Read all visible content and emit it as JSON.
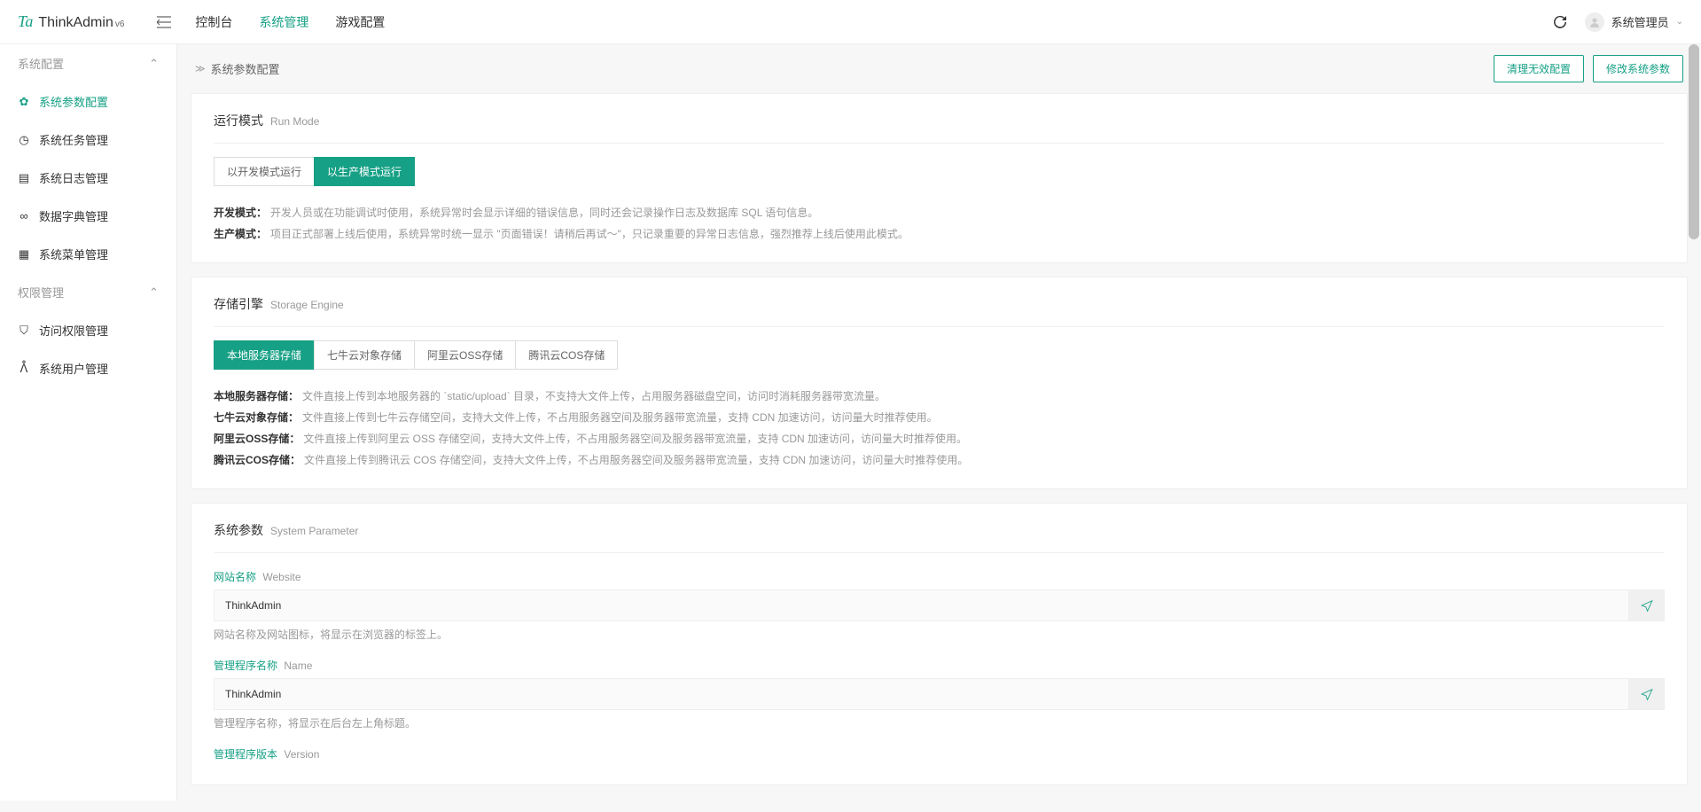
{
  "brand": {
    "name": "ThinkAdmin",
    "sup": "v6"
  },
  "topnav": [
    {
      "label": "控制台"
    },
    {
      "label": "系统管理"
    },
    {
      "label": "游戏配置"
    }
  ],
  "user": {
    "name": "系统管理员"
  },
  "sidebar": {
    "groups": [
      {
        "title": "系统配置",
        "items": [
          {
            "icon": "gear",
            "label": "系统参数配置",
            "active": true
          },
          {
            "icon": "clock",
            "label": "系统任务管理"
          },
          {
            "icon": "doc",
            "label": "系统日志管理"
          },
          {
            "icon": "loop",
            "label": "数据字典管理"
          },
          {
            "icon": "menu",
            "label": "系统菜单管理"
          }
        ]
      },
      {
        "title": "权限管理",
        "items": [
          {
            "icon": "shield",
            "label": "访问权限管理"
          },
          {
            "icon": "user",
            "label": "系统用户管理"
          }
        ]
      }
    ]
  },
  "page": {
    "breadcrumb_title": "系统参数配置",
    "actions": {
      "clean": "清理无效配置",
      "modify": "修改系统参数"
    }
  },
  "run_mode": {
    "title": "运行模式",
    "title_en": "Run Mode",
    "tabs": [
      "以开发模式运行",
      "以生产模式运行"
    ],
    "desc1_b": "开发模式：",
    "desc1": "开发人员或在功能调试时使用，系统异常时会显示详细的错误信息，同时还会记录操作日志及数据库 SQL 语句信息。",
    "desc2_b": "生产模式：",
    "desc2": "项目正式部署上线后使用，系统异常时统一显示 \"页面错误！请稍后再试～\"，只记录重要的异常日志信息，强烈推荐上线后使用此模式。"
  },
  "storage": {
    "title": "存储引擎",
    "title_en": "Storage Engine",
    "tabs": [
      "本地服务器存储",
      "七牛云对象存储",
      "阿里云OSS存储",
      "腾讯云COS存储"
    ],
    "d1_b": "本地服务器存储：",
    "d1": "文件直接上传到本地服务器的 `static/upload` 目录，不支持大文件上传，占用服务器磁盘空间，访问时消耗服务器带宽流量。",
    "d2_b": "七牛云对象存储：",
    "d2": "文件直接上传到七牛云存储空间，支持大文件上传，不占用服务器空间及服务器带宽流量，支持 CDN 加速访问，访问量大时推荐使用。",
    "d3_b": "阿里云OSS存储：",
    "d3": "文件直接上传到阿里云 OSS 存储空间，支持大文件上传，不占用服务器空间及服务器带宽流量，支持 CDN 加速访问，访问量大时推荐使用。",
    "d4_b": "腾讯云COS存储：",
    "d4": "文件直接上传到腾讯云 COS 存储空间，支持大文件上传，不占用服务器空间及服务器带宽流量，支持 CDN 加速访问，访问量大时推荐使用。"
  },
  "params": {
    "title": "系统参数",
    "title_en": "System Parameter",
    "fields": [
      {
        "label": "网站名称",
        "label_en": "Website",
        "value": "ThinkAdmin",
        "hint": "网站名称及网站图标，将显示在浏览器的标签上。"
      },
      {
        "label": "管理程序名称",
        "label_en": "Name",
        "value": "ThinkAdmin",
        "hint": "管理程序名称，将显示在后台左上角标题。"
      },
      {
        "label": "管理程序版本",
        "label_en": "Version",
        "value": "",
        "hint": ""
      }
    ]
  }
}
